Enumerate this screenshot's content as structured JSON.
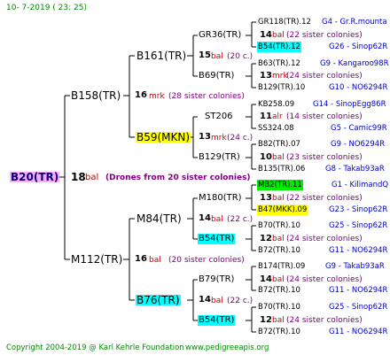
{
  "header_date": "10-  7-2019 ( 23: 25)",
  "footer": {
    "copyright": "Copyright 2004-2019 @ Karl Kehrle Foundation",
    "site": "www.pedigreeapis.org"
  },
  "colors": {
    "mark": "#800080",
    "blue_text": "#0000cc",
    "red": "#cc0000",
    "green": "#008800",
    "highlight_yellow": "#ffff00",
    "highlight_cyan": "#00ffff",
    "highlight_green": "#00ee00",
    "highlight_pink": "#ffaaff"
  },
  "root": {
    "name": "B20(TR)",
    "gen": "18",
    "mark": "bal",
    "note": "(Drones from 20 sister colonies)"
  },
  "l1": [
    {
      "name": "B158(TR)",
      "gen": "16",
      "mark": "mrk",
      "note": "(28 sister colonies)"
    },
    {
      "name": "M112(TR)",
      "gen": "16",
      "mark": "bal",
      "note": "(20 sister colonies)"
    }
  ],
  "l2": [
    {
      "name": "B161(TR)",
      "gen": "15",
      "mark": "bal",
      "note": "(20 c.)"
    },
    {
      "name": "B59(MKN)",
      "gen": "13",
      "mark": "mrk",
      "note": "(24 c.)"
    },
    {
      "name": "M84(TR)",
      "gen": "14",
      "mark": "bal",
      "note": "(22 c.)"
    },
    {
      "name": "B76(TR)",
      "gen": "14",
      "mark": "bal",
      "note": "(22 c.)"
    }
  ],
  "l3": [
    {
      "name": "GR36(TR)",
      "gen": "14",
      "mark": "bal",
      "note": "(22 sister colonies)"
    },
    {
      "name": "B69(TR)",
      "gen": "13",
      "mark": "mrk",
      "note": "(24 sister colonies)"
    },
    {
      "name": "ST206",
      "gen": "11",
      "mark": "alr",
      "note": "(14 sister colonies)"
    },
    {
      "name": "B129(TR)",
      "gen": "10",
      "mark": "bal",
      "note": "(23 sister colonies)"
    },
    {
      "name": "M180(TR)",
      "gen": "13",
      "mark": "bal",
      "note": "(22 sister colonies)"
    },
    {
      "name": "B54(TR)",
      "gen": "12",
      "mark": "bal",
      "note": "(24 sister colonies)"
    },
    {
      "name": "B79(TR)",
      "gen": "14",
      "mark": "bal",
      "note": "(24 sister colonies)"
    },
    {
      "name": "B54(TR)",
      "gen": "12",
      "mark": "bal",
      "note": "(24 sister colonies)"
    }
  ],
  "l4": [
    {
      "name": "GR118(TR).12",
      "info": "G4 - Gr.R.mounta"
    },
    {
      "name": "B54(TR).12",
      "info": "G26 - Sinop62R"
    },
    {
      "name": "B63(TR).12",
      "info": "G9 - Kangaroo98R"
    },
    {
      "name": "B129(TR).10",
      "info": "G10 - NO6294R"
    },
    {
      "name": "KB258.09",
      "info": "G14 - SinopEgg86R"
    },
    {
      "name": "SS324.08",
      "info": "G5 - Camic99R"
    },
    {
      "name": "B82(TR).07",
      "info": "G9 - NO6294R"
    },
    {
      "name": "B135(TR).06",
      "info": "G8 - Takab93aR"
    },
    {
      "name": "MB2(TR).11",
      "info": "G1 - KilimandQ"
    },
    {
      "name": "B47(MKK).09",
      "info": "G23 - Sinop62R"
    },
    {
      "name": "B70(TR).10",
      "info": "G25 - Sinop62R"
    },
    {
      "name": "B72(TR).10",
      "info": "G11 - NO6294R"
    },
    {
      "name": "B174(TR).09",
      "info": "G9 - Takab93aR"
    },
    {
      "name": "B72(TR).10",
      "info": "G11 - NO6294R"
    },
    {
      "name": "B70(TR).10",
      "info": "G25 - Sinop62R"
    },
    {
      "name": "B72(TR).10",
      "info": "G11 - NO6294R"
    }
  ]
}
